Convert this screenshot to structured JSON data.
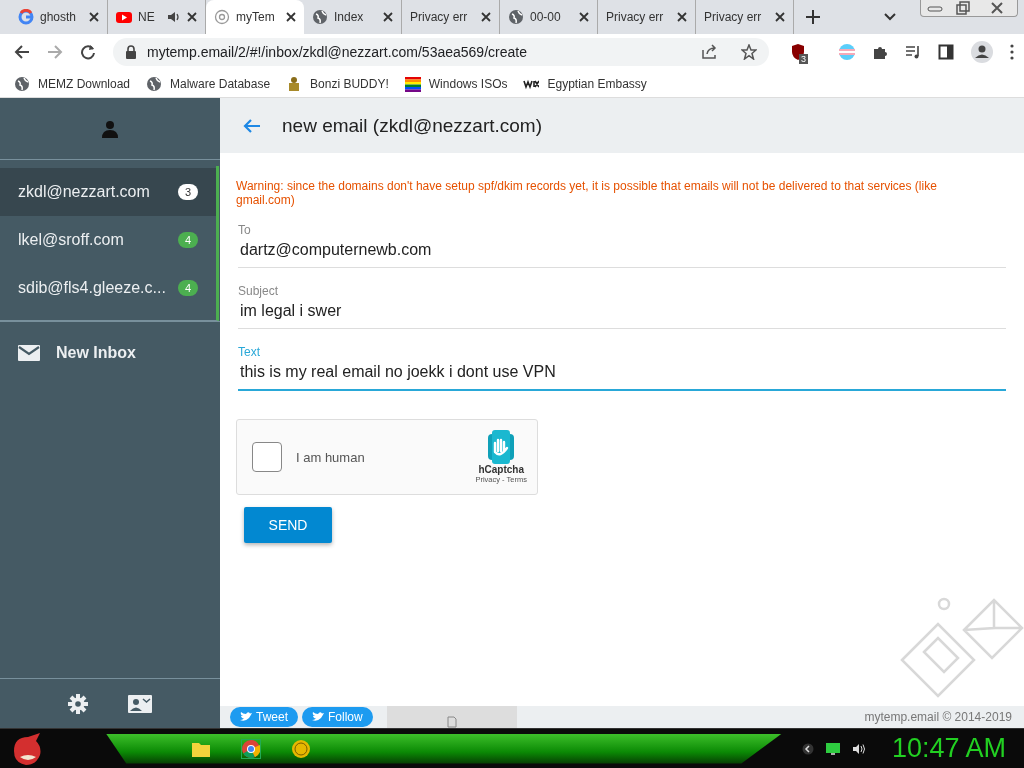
{
  "browser": {
    "tabs": [
      {
        "title": "ghosth",
        "kind": "google",
        "selected": false,
        "audio": false
      },
      {
        "title": "NE",
        "kind": "youtube",
        "selected": false,
        "audio": true
      },
      {
        "title": "myTem",
        "kind": "at",
        "selected": true,
        "audio": false
      },
      {
        "title": "Index",
        "kind": "globe",
        "selected": false,
        "audio": false
      },
      {
        "title": "Privacy err",
        "kind": "plain",
        "selected": false,
        "audio": false
      },
      {
        "title": "00-00",
        "kind": "globe",
        "selected": false,
        "audio": false
      },
      {
        "title": "Privacy err",
        "kind": "plain",
        "selected": false,
        "audio": false
      },
      {
        "title": "Privacy err",
        "kind": "plain",
        "selected": false,
        "audio": false
      }
    ],
    "url": "mytemp.email/2/#!/inbox/zkdl@nezzart.com/53aea569/create",
    "extension_badge": "3",
    "bookmarks": [
      {
        "label": "MEMZ Download",
        "kind": "globe"
      },
      {
        "label": "Malware Database",
        "kind": "globe"
      },
      {
        "label": "Bonzi BUDDY!",
        "kind": "figure"
      },
      {
        "label": "Windows ISOs",
        "kind": "stripes"
      },
      {
        "label": "Egyptian Embassy",
        "kind": "wix"
      }
    ]
  },
  "sidebar": {
    "accounts": [
      {
        "address": "zkdl@nezzart.com",
        "count": "3",
        "selected": true
      },
      {
        "address": "lkel@sroff.com",
        "count": "4",
        "selected": false
      },
      {
        "address": "sdib@fls4.gleeze.c...",
        "count": "4",
        "selected": false
      }
    ],
    "new_inbox": "New Inbox"
  },
  "compose": {
    "title": "new email (zkdl@nezzart.com)",
    "warning": "Warning: since the domains don't have setup spf/dkim records yet, it is possible that emails will not be delivered to that services (like gmail.com)",
    "fields": [
      {
        "label": "To",
        "value": "dartz@computernewb.com",
        "focused": false
      },
      {
        "label": "Subject",
        "value": "im legal i swer",
        "focused": false
      },
      {
        "label": "Text",
        "value": "this is my real email no joekk i dont use VPN",
        "focused": true
      }
    ],
    "captcha": {
      "label": "I am human",
      "checked": false,
      "brand": "hCaptcha",
      "links": "Privacy - Terms"
    },
    "send": "SEND"
  },
  "footer": {
    "tweet": "Tweet",
    "follow": "Follow",
    "copyright": "mytemp.email © 2014-2019"
  },
  "taskbar": {
    "clock": "10:47 AM"
  }
}
